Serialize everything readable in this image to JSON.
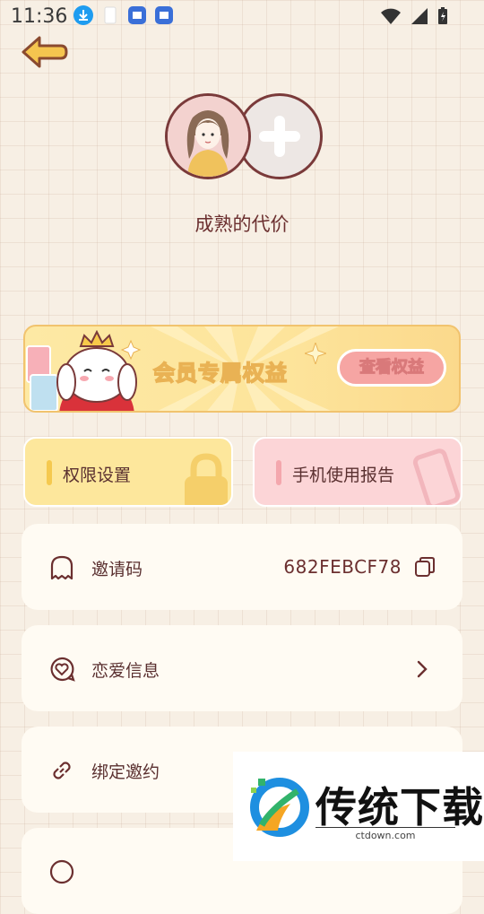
{
  "status_bar": {
    "time": "11:36",
    "icons": [
      "download-icon",
      "sim-icon",
      "app-icon",
      "app-icon",
      "wifi-icon",
      "signal-icon",
      "battery-icon"
    ]
  },
  "header": {
    "back_icon": "arrow-left-icon"
  },
  "profile": {
    "nickname": "成熟的代价",
    "add_icon": "plus-icon"
  },
  "vip_banner": {
    "title": "会员专属权益",
    "button_label": "查看权益"
  },
  "quick_cards": [
    {
      "label": "权限设置",
      "icon": "lock-icon",
      "accent": "#f5c94f"
    },
    {
      "label": "手机使用报告",
      "icon": "phone-icon",
      "accent": "#f4a7ad"
    }
  ],
  "list": [
    {
      "label": "邀请码",
      "icon": "ghost-icon",
      "value": "682FEBCF78",
      "action_icon": "copy-icon"
    },
    {
      "label": "恋爱信息",
      "icon": "heart-bubble-icon",
      "action_icon": "chevron-right-icon"
    },
    {
      "label": "绑定邀约",
      "icon": "link-icon"
    },
    {
      "label": "",
      "icon": "info-icon"
    }
  ],
  "watermark": {
    "title": "传统下载",
    "url": "ctdown.com"
  },
  "colors": {
    "primary_text": "#6b2f2f",
    "background": "#f7efe4",
    "card": "#fffbf3"
  }
}
